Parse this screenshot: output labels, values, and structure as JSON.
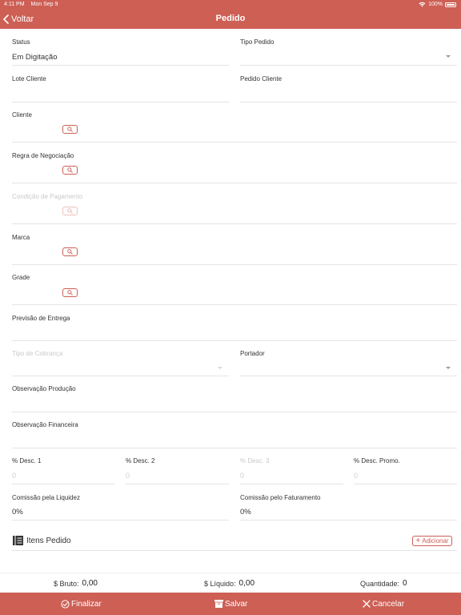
{
  "status_bar": {
    "time": "4:11 PM",
    "date": "Mon Sep 9",
    "battery": "100%"
  },
  "nav": {
    "back_label": "Voltar",
    "title": "Pedido"
  },
  "form": {
    "status": {
      "label": "Status",
      "value": "Em Digitação"
    },
    "tipo_pedido": {
      "label": "Tipo Pedido",
      "value": ""
    },
    "lote_cliente": {
      "label": "Lote Cliente",
      "value": ""
    },
    "pedido_cliente": {
      "label": "Pedido Cliente",
      "value": ""
    },
    "cliente": {
      "label": "Cliente"
    },
    "regra_negociacao": {
      "label": "Regra de Negociação"
    },
    "condicao_pagamento": {
      "label": "Condição de Pagamento"
    },
    "marca": {
      "label": "Marca"
    },
    "grade": {
      "label": "Grade"
    },
    "previsao_entrega": {
      "label": "Previsão de Entrega",
      "value": ""
    },
    "tipo_cobranca": {
      "label": "Tipo de Cobrança",
      "value": ""
    },
    "portador": {
      "label": "Portador",
      "value": ""
    },
    "observacao_producao": {
      "label": "Observação Produção",
      "value": ""
    },
    "observacao_financeira": {
      "label": "Observação Financeira",
      "value": ""
    },
    "desc1": {
      "label": "% Desc. 1",
      "placeholder": "0"
    },
    "desc2": {
      "label": "% Desc. 2",
      "placeholder": "0"
    },
    "desc3": {
      "label": "% Desc. 3",
      "placeholder": "0"
    },
    "desc_promo": {
      "label": "% Desc. Promo.",
      "placeholder": "0"
    },
    "comissao_liquidez": {
      "label": "Comissão pela Liquidez",
      "value": "0%"
    },
    "comissao_faturamento": {
      "label": "Comissão pelo Faturamento",
      "value": "0%"
    }
  },
  "items": {
    "title": "Itens Pedido",
    "add_label": "Adicionar"
  },
  "totals": {
    "bruto_label": "$ Bruto:",
    "bruto_value": "0,00",
    "liquido_label": "$ Líquido:",
    "liquido_value": "0,00",
    "quantidade_label": "Quantidade:",
    "quantidade_value": "0"
  },
  "toolbar": {
    "finalizar": "Finalizar",
    "salvar": "Salvar",
    "cancelar": "Cancelar"
  },
  "colors": {
    "accent": "#cd5f55",
    "divider": "#e4e4e4",
    "disabled_text": "#c9c9c9"
  },
  "icons": {
    "wifi": "wifi-icon",
    "battery": "battery-icon",
    "back": "chevron-left-icon",
    "search": "magnifier-icon",
    "list": "list-icon",
    "add": "plus-icon",
    "finalizar": "check-circle-icon",
    "salvar": "archive-icon",
    "cancelar": "close-icon"
  }
}
